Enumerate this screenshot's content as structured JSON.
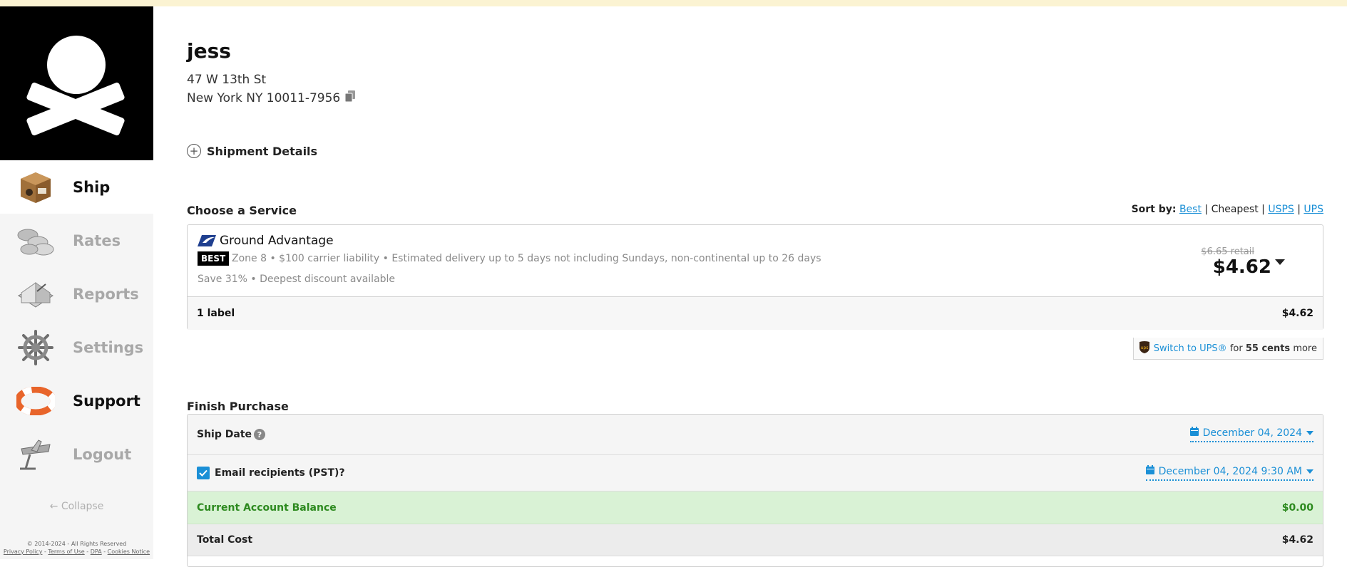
{
  "sidebar": {
    "items": [
      {
        "label": "Ship",
        "icon": "box-icon"
      },
      {
        "label": "Rates",
        "icon": "coins-icon"
      },
      {
        "label": "Reports",
        "icon": "book-icon"
      },
      {
        "label": "Settings",
        "icon": "ship-wheel-icon"
      },
      {
        "label": "Support",
        "icon": "life-ring-icon"
      },
      {
        "label": "Logout",
        "icon": "plane-icon"
      }
    ],
    "collapse_label": "← Collapse",
    "footer": {
      "copyright": "© 2014-2024 - All Rights Reserved",
      "privacy": "Privacy Policy",
      "terms": "Terms of Use",
      "dpa": "DPA",
      "cookies": "Cookies Notice",
      "sep": " - "
    }
  },
  "recipient": {
    "name": "jess",
    "address_line1": "47 W 13th St",
    "address_line2": "New York NY 10011-7956"
  },
  "shipment_details_label": "Shipment Details",
  "choose_service": {
    "title": "Choose a Service",
    "sort_label": "Sort by:",
    "sort_best": "Best",
    "sort_cheapest": "Cheapest",
    "sort_usps": "USPS",
    "sort_ups": "UPS",
    "sort_sep": " | "
  },
  "service": {
    "name": "Ground Advantage",
    "badge": "BEST",
    "description": "Zone 8 • $100 carrier liability • Estimated delivery up to 5 days not including Sundays, non-continental up to 26 days",
    "savings": "Save 31% • Deepest discount available",
    "retail": "$6.65 retail",
    "price": "$4.62",
    "label_count": "1 label",
    "label_price": "$4.62"
  },
  "ups_switch": {
    "link": "Switch to UPS®",
    "middle": " for ",
    "amount": "55 cents",
    "suffix": " more"
  },
  "finish_purchase": {
    "title": "Finish Purchase",
    "ship_date_label": "Ship Date",
    "help": "?",
    "ship_date_value": "December 04, 2024",
    "email_label": "Email recipients (PST)?",
    "email_value": "December 04, 2024 9:30 AM",
    "balance_label": "Current Account Balance",
    "balance_value": "$0.00",
    "total_label": "Total Cost",
    "total_value": "$4.62"
  },
  "colors": {
    "accent": "#1a8fd6",
    "balance_green": "#2d8a1f",
    "balance_bg": "#d9f2d5",
    "banner": "#fbf3d2"
  }
}
